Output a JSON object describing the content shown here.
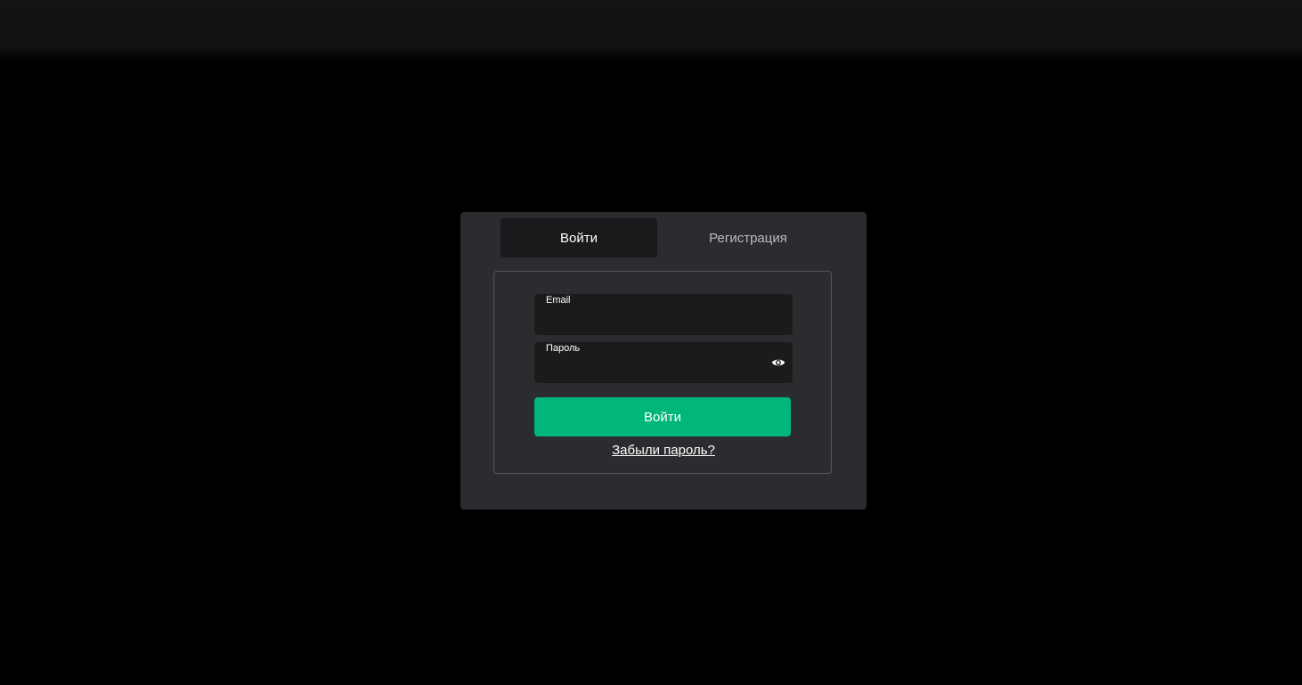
{
  "tabs": {
    "login": "Войти",
    "register": "Регистрация"
  },
  "form": {
    "email": {
      "label": "Email",
      "value": ""
    },
    "password": {
      "label": "Пароль",
      "value": "",
      "toggle_icon": "eye-icon"
    },
    "submit_label": "Войти",
    "forgot_label": "Забыли пароль?"
  },
  "colors": {
    "accent": "#00b67a",
    "page_background": "#000000",
    "card_background": "#2b2c2f"
  }
}
